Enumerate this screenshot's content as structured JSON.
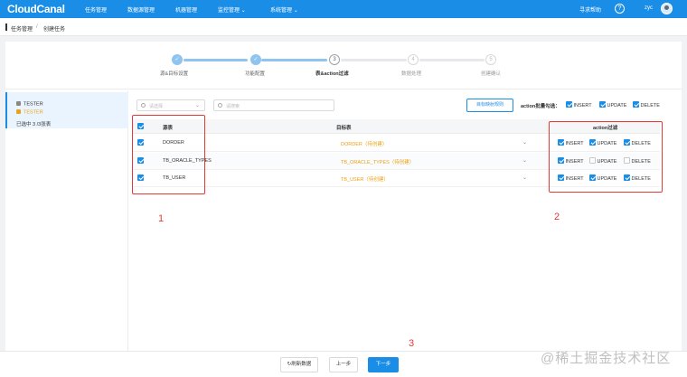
{
  "app": {
    "logo": "CloudCanal"
  },
  "nav": {
    "items": [
      "任务管理",
      "数据源管理",
      "机器管理",
      "监控管理",
      "系统管理"
    ],
    "help": "寻求帮助",
    "help_icon": "?",
    "user": "zyc"
  },
  "breadcrumb": {
    "items": [
      "任务管理",
      "创建任务"
    ],
    "separator": "/"
  },
  "steps": [
    {
      "label": "源&目标设置",
      "state": "done",
      "number": "✓"
    },
    {
      "label": "功能配置",
      "state": "done",
      "number": "✓"
    },
    {
      "label": "表&action过滤",
      "state": "current",
      "number": "3"
    },
    {
      "label": "数据处理",
      "state": "todo",
      "number": "4"
    },
    {
      "label": "创建确认",
      "state": "todo",
      "number": "5"
    }
  ],
  "left_panel": {
    "source_db": "TESTER",
    "target_db": "TESTER",
    "summary": "已选中 3 /3张表"
  },
  "filters": {
    "select_placeholder": "请选择",
    "search_placeholder": "请搜索",
    "map_button": "目标映射规则",
    "batch_label": "action批量勾选：",
    "batch_items": [
      {
        "label": "INSERT",
        "checked": true
      },
      {
        "label": "UPDATE",
        "checked": true
      },
      {
        "label": "DELETE",
        "checked": true
      }
    ]
  },
  "table": {
    "columns": {
      "source": "源表",
      "target": "目标表",
      "actions": "action过滤"
    },
    "rows": [
      {
        "source": "DORDER",
        "target": "DORDER（待创建）",
        "insert": true,
        "update": true,
        "delete": true
      },
      {
        "source": "TB_ORACLE_TYPES",
        "target": "TB_ORACLE_TYPES（待创建）",
        "insert": true,
        "update": false,
        "delete": false
      },
      {
        "source": "TB_USER",
        "target": "TB_USER（待创建）",
        "insert": true,
        "update": true,
        "delete": true
      }
    ],
    "action_labels": [
      "INSERT",
      "UPDATE",
      "DELETE"
    ]
  },
  "annotations": [
    "1",
    "2",
    "3"
  ],
  "footer": {
    "refresh": "刷新数据",
    "prev": "上一步",
    "next": "下一步"
  },
  "watermark": "@稀土掘金技术社区",
  "colors": {
    "primary": "#1a8ee6",
    "target_text": "#e8a317",
    "annotation": "#e53935"
  }
}
